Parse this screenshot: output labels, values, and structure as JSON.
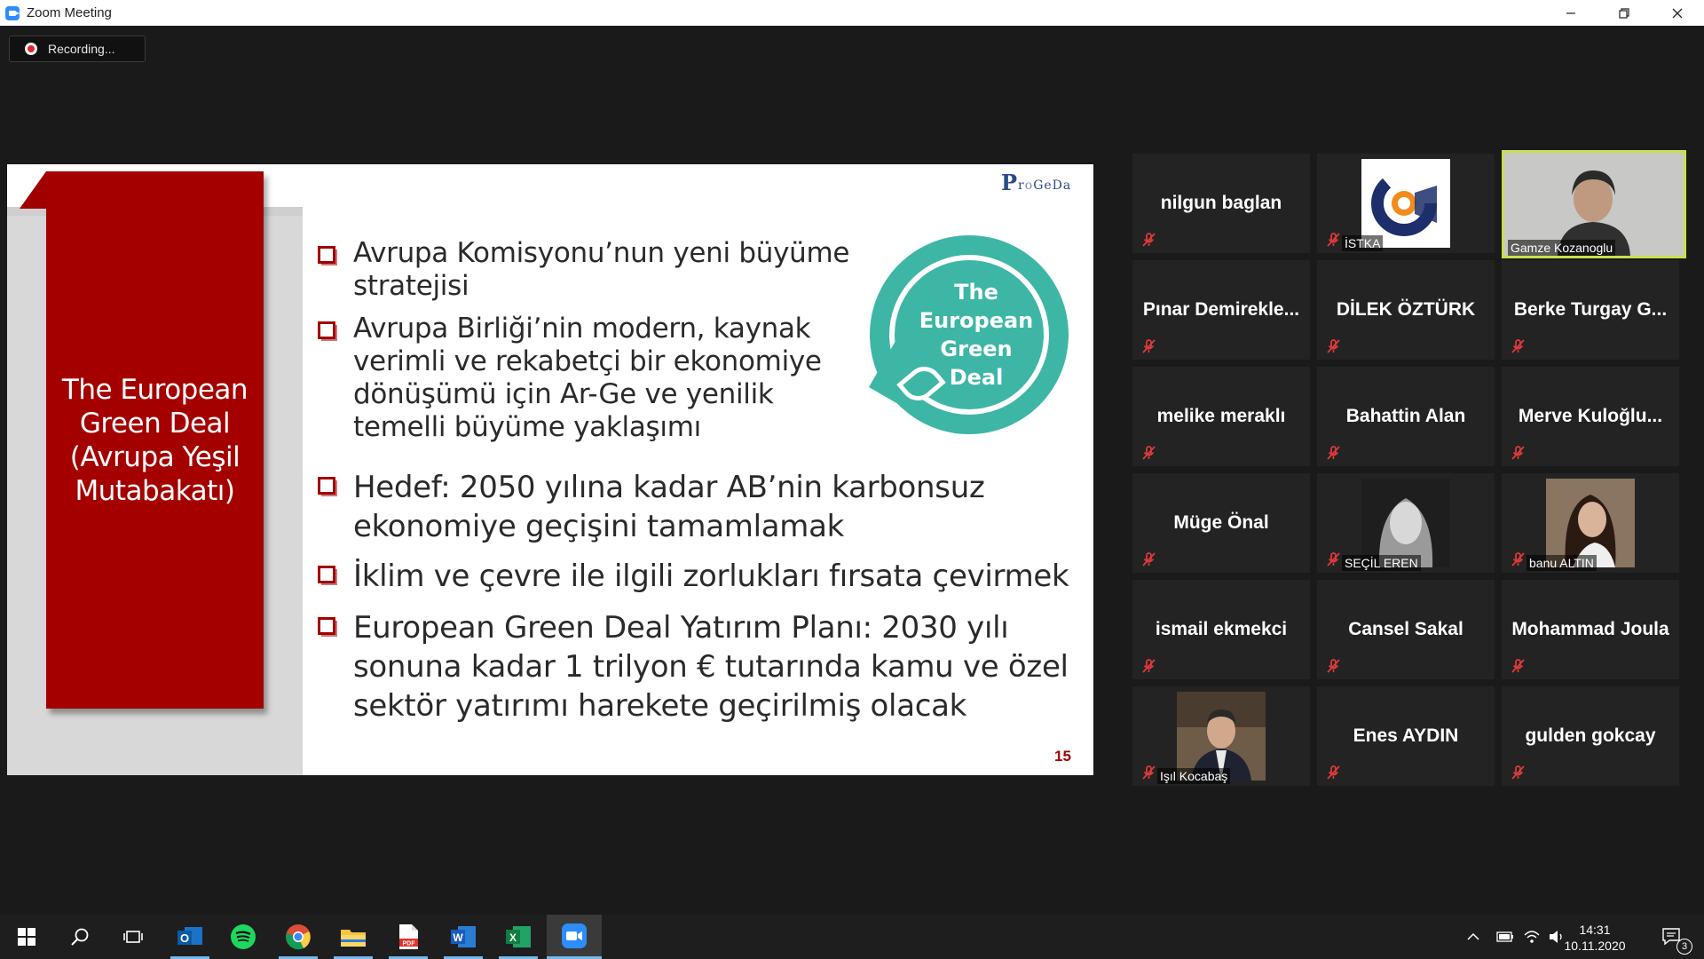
{
  "window": {
    "title": "Zoom Meeting",
    "controls": [
      "minimize",
      "restore",
      "close"
    ]
  },
  "recording": {
    "label": "Recording..."
  },
  "slide": {
    "side_title": "The European Green Deal (Avrupa Yeşil Mutabakatı)",
    "logo": {
      "first": "P",
      "rest_a": "r",
      "rest_o": "o",
      "rest_b": "GeDa"
    },
    "badge_lines": [
      "The",
      "European",
      "Green",
      "Deal"
    ],
    "bullets": [
      "Avrupa Komisyonu’nun yeni büyüme stratejisi",
      "Avrupa Birliği’nin modern, kaynak verimli ve rekabetçi bir ekonomiye dönüşümü için Ar-Ge ve yenilik temelli büyüme yaklaşımı",
      "Hedef: 2050 yılına kadar AB’nin karbonsuz ekonomiye geçişini tamamlamak",
      "İklim ve çevre ile ilgili zorlukları fırsata çevirmek",
      "European Green Deal Yatırım Planı: 2030 yılı sonuna kadar 1 trilyon € tutarında kamu ve özel sektör yatırımı harekete geçirilmiş olacak"
    ],
    "bullet_lines": [
      [
        "Avrupa Komisyonu’nun yeni büyüme",
        "stratejisi"
      ],
      [
        "Avrupa Birliği’nin modern, kaynak",
        "verimli ve rekabetçi bir ekonomiye",
        "dönüşümü için Ar-Ge ve yenilik",
        "temelli büyüme yaklaşımı"
      ],
      [
        "Hedef: 2050 yılına kadar AB’nin karbonsuz",
        "ekonomiye geçişini tamamlamak"
      ],
      [
        "İklim ve çevre ile ilgili zorlukları fırsata çevirmek"
      ],
      [
        "European Green Deal Yatırım Planı: 2030 yılı",
        "sonuna kadar 1 trilyon € tutarında kamu ve özel",
        "sektör yatırımı harekete geçirilmiş olacak"
      ]
    ],
    "page_number": "15"
  },
  "participants": [
    {
      "name": "nilgun baglan",
      "type": "name",
      "muted": true
    },
    {
      "name": "İSTKA",
      "type": "logo",
      "muted": true
    },
    {
      "name": "Gamze Kozanoglu",
      "type": "video",
      "muted": false,
      "speaking": true
    },
    {
      "name": "Pınar  Demirekle...",
      "type": "name",
      "muted": true
    },
    {
      "name": "DİLEK ÖZTÜRK",
      "type": "name",
      "muted": true
    },
    {
      "name": "Berke Turgay G...",
      "type": "name",
      "muted": true
    },
    {
      "name": "melike meraklı",
      "type": "name",
      "muted": true
    },
    {
      "name": "Bahattin Alan",
      "type": "name",
      "muted": true
    },
    {
      "name": "Merve  Kuloğlu...",
      "type": "name",
      "muted": true
    },
    {
      "name": "Müge Önal",
      "type": "name",
      "muted": true
    },
    {
      "name": "SEÇİL EREN",
      "type": "photo",
      "muted": true
    },
    {
      "name": "banu ALTIN",
      "type": "photo",
      "muted": true
    },
    {
      "name": "ismail ekmekci",
      "type": "name",
      "muted": true
    },
    {
      "name": "Cansel Sakal",
      "type": "name",
      "muted": true
    },
    {
      "name": "Mohammad Joula",
      "type": "name",
      "muted": true
    },
    {
      "name": "Işıl Kocabaş",
      "type": "photo",
      "muted": true
    },
    {
      "name": "Enes AYDIN",
      "type": "name",
      "muted": true
    },
    {
      "name": "gulden gokcay",
      "type": "name",
      "muted": true
    }
  ],
  "taskbar": {
    "apps": [
      "start-icon",
      "search-icon",
      "task-view-icon",
      "outlook-icon",
      "spotify-icon",
      "chrome-icon",
      "file-explorer-icon",
      "pdf-icon",
      "word-icon",
      "excel-icon",
      "zoom-icon"
    ],
    "time": "14:31",
    "date": "10.11.2020",
    "notifications": "3"
  },
  "colors": {
    "slide_red": "#a40000",
    "badge_teal": "#3db6a6",
    "speaker_border": "#c6e14f",
    "tile_bg": "#232323",
    "mute_red": "#e03a3a"
  }
}
